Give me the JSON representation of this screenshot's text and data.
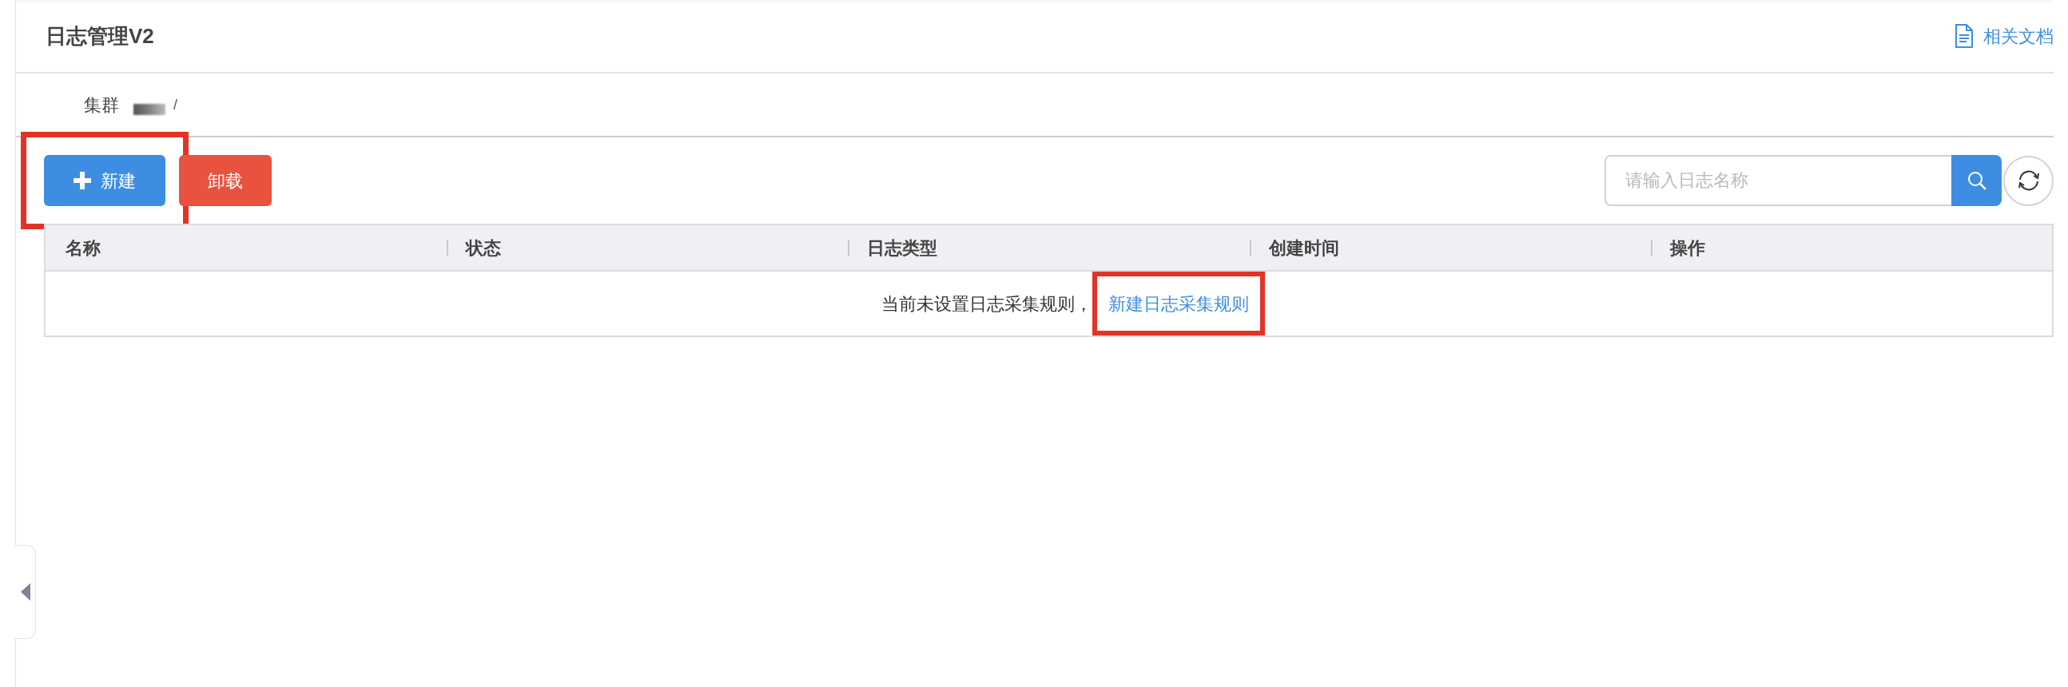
{
  "header": {
    "title": "日志管理V2",
    "docs_link": "相关文档"
  },
  "cluster": {
    "label": "集群",
    "separator": "/"
  },
  "toolbar": {
    "buttons": [
      {
        "kind": "primary",
        "label": "新建",
        "highlighted": true
      },
      {
        "kind": "danger",
        "label": "卸载",
        "highlighted": false
      }
    ],
    "search": {
      "placeholder": "请输入日志名称"
    }
  },
  "table": {
    "columns": [
      "名称",
      "状态",
      "日志类型",
      "创建时间",
      "操作"
    ],
    "empty": {
      "message": "当前未设置日志采集规则，",
      "link": "新建日志采集规则",
      "highlighted": true
    }
  }
}
